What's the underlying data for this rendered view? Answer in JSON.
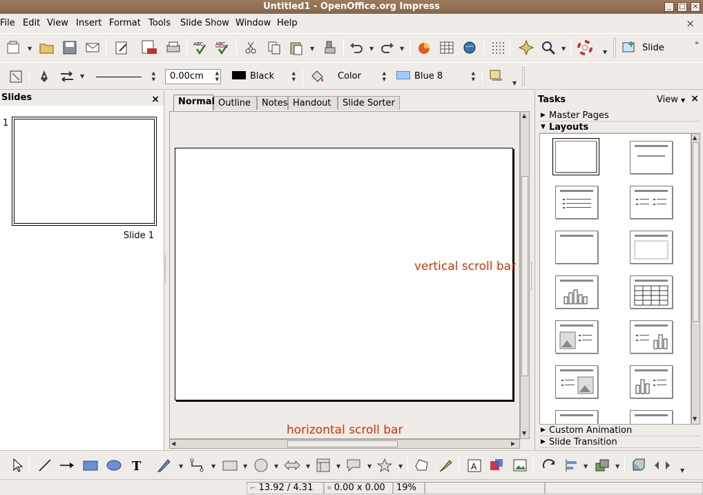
{
  "window": {
    "title": "Untitled1 - OpenOffice.org Impress",
    "minimize": "_",
    "maximize": "□",
    "close": "×"
  },
  "menu": {
    "items": [
      "File",
      "Edit",
      "View",
      "Insert",
      "Format",
      "Tools",
      "Slide Show",
      "Window",
      "Help"
    ],
    "close_doc": "×"
  },
  "standard_toolbar": {
    "slide_label": "Slide"
  },
  "line_toolbar": {
    "line_width": "0.00cm",
    "line_color": "Black",
    "line_color_hex": "#000000",
    "area_style": "Color",
    "area_color": "Blue 8",
    "area_color_hex": "#99ccff"
  },
  "slides_pane": {
    "title": "Slides",
    "close": "×",
    "slide_number": "1",
    "slide_caption": "Slide 1"
  },
  "view_tabs": [
    "Normal",
    "Outline",
    "Notes",
    "Handout",
    "Slide Sorter"
  ],
  "active_tab": "Normal",
  "annotations": {
    "vertical": "vertical scroll bar",
    "horizontal": "horizontal scroll bar"
  },
  "tasks_pane": {
    "title": "Tasks",
    "view": "View",
    "close": "×",
    "sections": {
      "master_pages": "Master Pages",
      "layouts": "Layouts",
      "custom_animation": "Custom Animation",
      "slide_transition": "Slide Transition"
    }
  },
  "status": {
    "position": "13.92 / 4.31",
    "size": "0.00 x 0.00",
    "zoom": "19%"
  },
  "colors": {
    "titlebar": "#8f7055",
    "annotation": "#cc3300"
  }
}
